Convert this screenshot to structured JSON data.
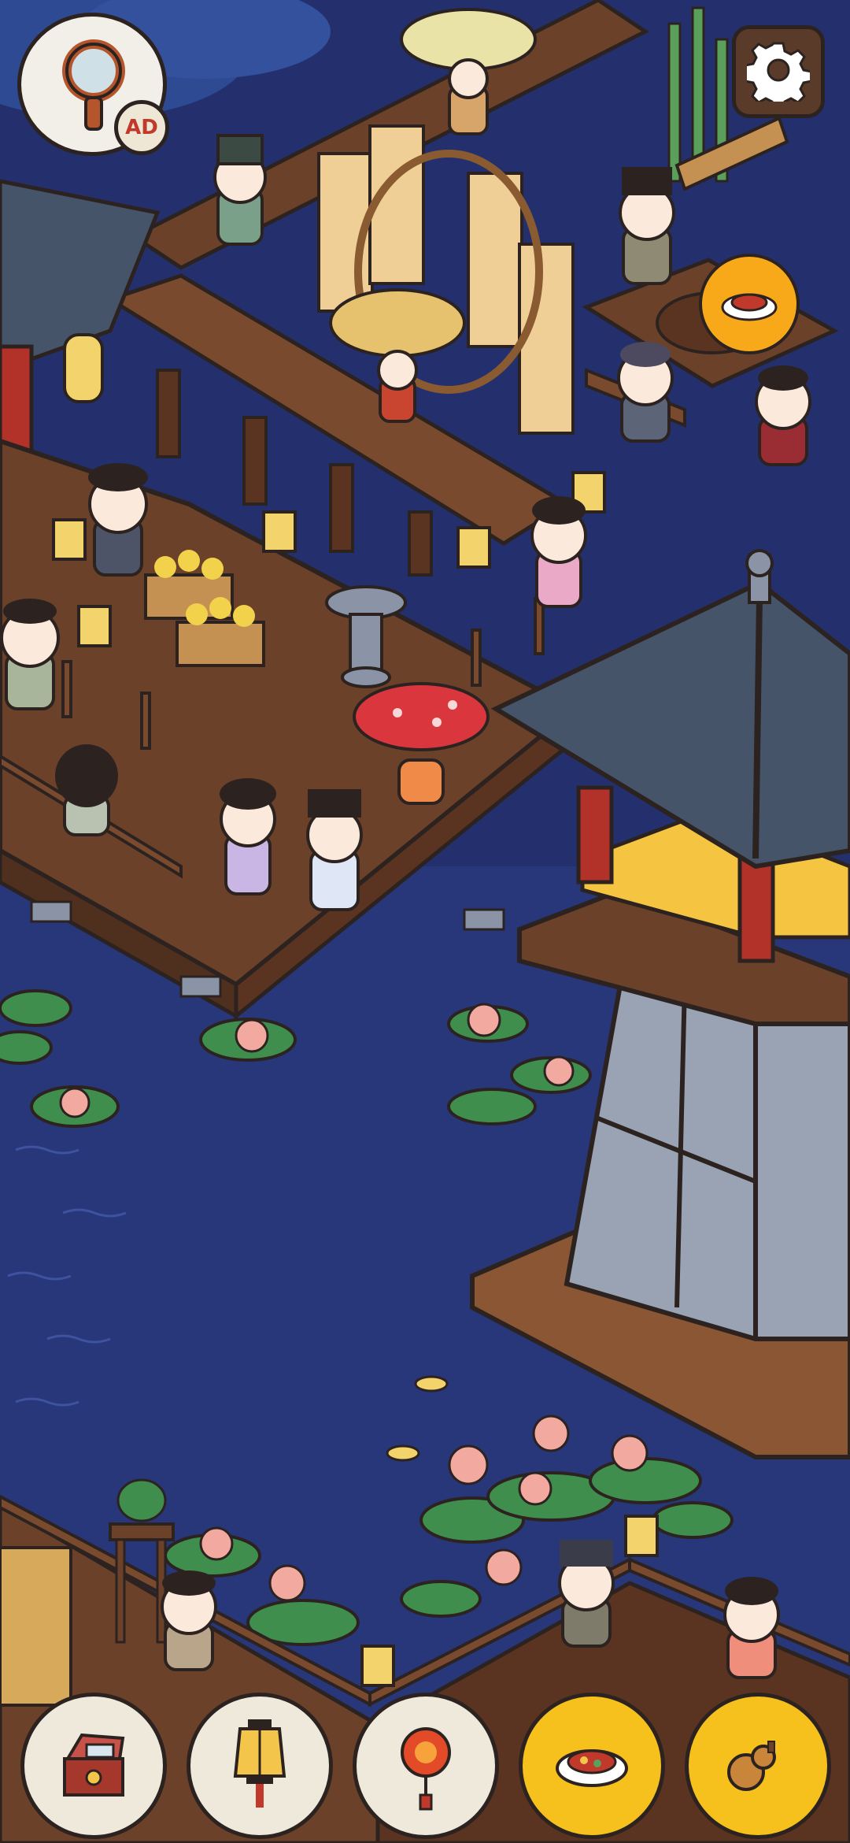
{
  "hud": {
    "search_button": {
      "icon": "magnifier-icon",
      "badge_text": "AD"
    },
    "settings_button": {
      "icon": "gear-icon"
    },
    "order_bubble": {
      "icon": "food-dish-icon"
    }
  },
  "bottom_bar": {
    "buttons": [
      {
        "name": "treasure-chest-button",
        "icon": "treasure-chest-icon",
        "style": "light"
      },
      {
        "name": "lantern-button",
        "icon": "lantern-icon",
        "style": "light"
      },
      {
        "name": "firework-button",
        "icon": "firework-icon",
        "style": "light"
      },
      {
        "name": "food-dish-button",
        "icon": "food-dish-icon",
        "style": "yellow"
      },
      {
        "name": "gourd-button",
        "icon": "gourd-icon",
        "style": "yellow"
      }
    ]
  },
  "colors": {
    "water": "#24306e",
    "deck": "#6b4129",
    "roof": "#455468",
    "pillar": "#b2322a",
    "lantern_glow": "#f3d36b",
    "lotus_leaf": "#3f8e4e",
    "lotus_flower": "#f2a9a0",
    "button_yellow": "#f7c11d",
    "button_light": "#efe9dc"
  }
}
